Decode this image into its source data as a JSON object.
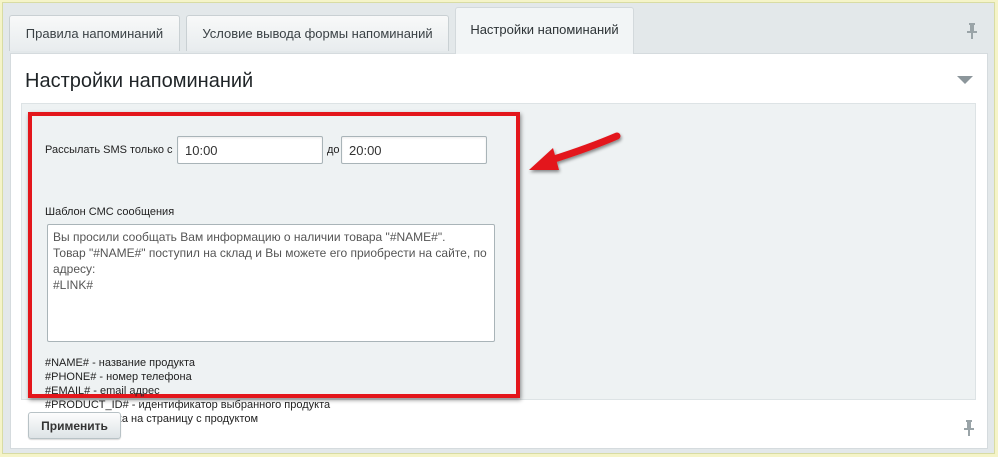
{
  "tabs": [
    {
      "label": "Правила напоминаний"
    },
    {
      "label": "Условие вывода формы напоминаний"
    },
    {
      "label": "Настройки напоминаний"
    }
  ],
  "active_tab": 2,
  "panel": {
    "title": "Настройки напоминаний"
  },
  "form": {
    "sms_label": "Рассылать SMS только с",
    "from_value": "10:00",
    "to_label": "до",
    "to_value": "20:00",
    "template_label": "Шаблон СМС сообщения",
    "template_value": "Вы просили сообщать Вам информацию о наличии товара \"#NAME#\".\nТовар \"#NAME#\" поступил на склад и Вы можете его приобрести на сайте, по адресу:\n#LINK#",
    "legend": [
      "#NAME# - название продукта",
      "#PHONE# - номер телефона",
      "#EMAIL# - email адрес",
      "#PRODUCT_ID# - идентификатор выбранного продукта",
      "#LINK# - ссылка на страницу с продуктом"
    ]
  },
  "footer": {
    "apply_label": "Применить"
  },
  "colors": {
    "highlight": "#e3161b",
    "arrow": "#e3161b",
    "page_bg": "#f5f4c8"
  },
  "icons": [
    "pin-icon",
    "collapse-arrow-icon",
    "red-arrow-annotation"
  ]
}
